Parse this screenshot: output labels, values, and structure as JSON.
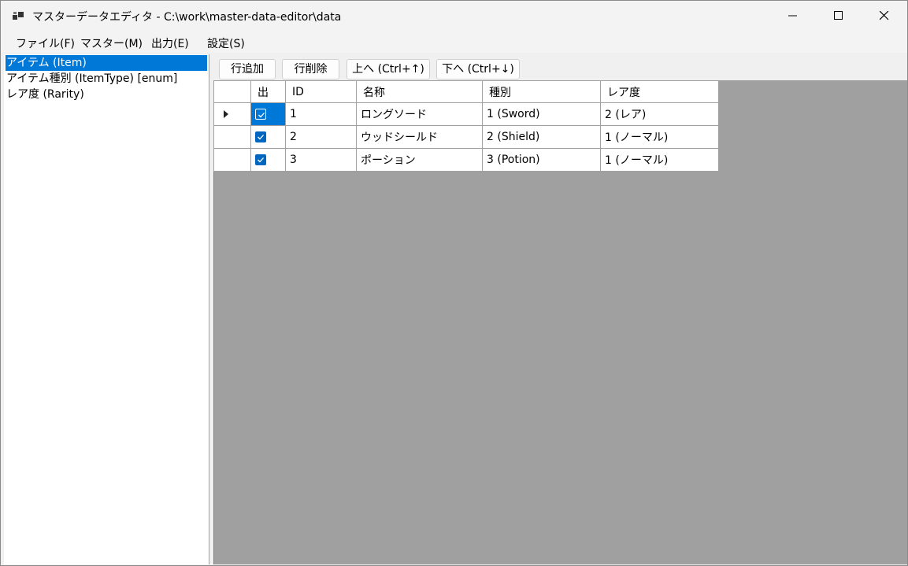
{
  "window": {
    "title": "マスターデータエディタ - C:\\work\\master-data-editor\\data"
  },
  "menu": [
    "ファイル(F)",
    "マスター(M)",
    "出力(E)",
    "設定(S)"
  ],
  "sidebar": {
    "items": [
      {
        "label": "アイテム (Item)",
        "selected": true
      },
      {
        "label": "アイテム種別 (ItemType) [enum]",
        "selected": false
      },
      {
        "label": "レア度 (Rarity)",
        "selected": false
      }
    ]
  },
  "toolbar": {
    "add_row": "行追加",
    "delete_row": "行削除",
    "move_up": "上へ (Ctrl+↑)",
    "move_down": "下へ (Ctrl+↓)"
  },
  "grid": {
    "columns": [
      "出",
      "ID",
      "名称",
      "種別",
      "レア度"
    ],
    "rows": [
      {
        "checked": true,
        "id": "1",
        "name": "ロングソード",
        "type": "1 (Sword)",
        "rarity": "2 (レア)",
        "current": true
      },
      {
        "checked": true,
        "id": "2",
        "name": "ウッドシールド",
        "type": "2 (Shield)",
        "rarity": "1 (ノーマル)",
        "current": false
      },
      {
        "checked": true,
        "id": "3",
        "name": "ポーション",
        "type": "3 (Potion)",
        "rarity": "1 (ノーマル)",
        "current": false
      }
    ]
  },
  "colors": {
    "selection": "#0078d7",
    "checkbox": "#0067c0",
    "grid_background": "#a0a0a0"
  }
}
